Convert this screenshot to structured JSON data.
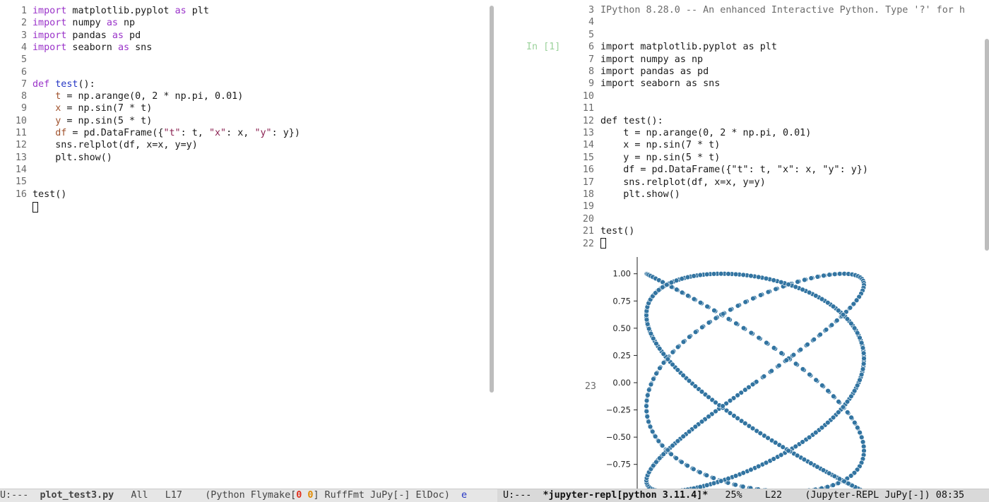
{
  "left_editor": {
    "lines": [
      {
        "n": "1",
        "html": "<span class='kw'>import</span> matplotlib.pyplot <span class='kw'>as</span> plt"
      },
      {
        "n": "2",
        "html": "<span class='kw'>import</span> numpy <span class='kw'>as</span> np"
      },
      {
        "n": "3",
        "html": "<span class='kw'>import</span> pandas <span class='kw'>as</span> pd"
      },
      {
        "n": "4",
        "html": "<span class='kw'>import</span> seaborn <span class='kw'>as</span> sns"
      },
      {
        "n": "5",
        "html": ""
      },
      {
        "n": "6",
        "html": ""
      },
      {
        "n": "7",
        "html": "<span class='kw'>def</span> <span class='fn'>test</span>():"
      },
      {
        "n": "8",
        "html": "    <span class='var'>t</span> = np.arange(0, 2 * np.pi, 0.01)"
      },
      {
        "n": "9",
        "html": "    <span class='var'>x</span> = np.sin(7 * t)"
      },
      {
        "n": "10",
        "html": "    <span class='var'>y</span> = np.sin(5 * t)"
      },
      {
        "n": "11",
        "html": "    <span class='var'>df</span> = pd.DataFrame({<span class='str'>\"t\"</span>: t, <span class='str'>\"x\"</span>: x, <span class='str'>\"y\"</span>: y})"
      },
      {
        "n": "12",
        "html": "    sns.relplot(df, x=x, y=y)"
      },
      {
        "n": "13",
        "html": "    plt.show()"
      },
      {
        "n": "14",
        "html": ""
      },
      {
        "n": "15",
        "html": ""
      },
      {
        "n": "16",
        "html": "test()"
      }
    ]
  },
  "repl": {
    "in_prompt": "In [1]",
    "lines": [
      {
        "n": "3",
        "text": "IPython 8.28.0 -- An enhanced Interactive Python. Type '?' for h"
      },
      {
        "n": "4",
        "text": ""
      },
      {
        "n": "5",
        "text": ""
      },
      {
        "n": "6",
        "text": "import matplotlib.pyplot as plt"
      },
      {
        "n": "7",
        "text": "import numpy as np"
      },
      {
        "n": "8",
        "text": "import pandas as pd"
      },
      {
        "n": "9",
        "text": "import seaborn as sns"
      },
      {
        "n": "10",
        "text": ""
      },
      {
        "n": "11",
        "text": ""
      },
      {
        "n": "12",
        "text": "def test():"
      },
      {
        "n": "13",
        "text": "    t = np.arange(0, 2 * np.pi, 0.01)"
      },
      {
        "n": "14",
        "text": "    x = np.sin(7 * t)"
      },
      {
        "n": "15",
        "text": "    y = np.sin(5 * t)"
      },
      {
        "n": "16",
        "text": "    df = pd.DataFrame({\"t\": t, \"x\": x, \"y\": y})"
      },
      {
        "n": "17",
        "text": "    sns.relplot(df, x=x, y=y)"
      },
      {
        "n": "18",
        "text": "    plt.show()"
      },
      {
        "n": "19",
        "text": ""
      },
      {
        "n": "20",
        "text": ""
      },
      {
        "n": "21",
        "text": "test()"
      },
      {
        "n": "22",
        "text": ""
      }
    ],
    "plot_line_number": "23"
  },
  "mode_line_left": {
    "status": "U:---  ",
    "buffer": "plot_test3.py",
    "pos": "   All   L17    ",
    "mode_prefix": "(Python Flymake[",
    "errors": "0",
    "warnings": "0",
    "mode_suffix": "] RuffFmt JuPy[-] ElDoc)  ",
    "trunc": "e"
  },
  "mode_line_right": {
    "status": " U:---  ",
    "buffer": "*jupyter-repl[python 3.11.4]*",
    "pos": "   25%    L22    ",
    "modes": "(Jupyter-REPL JuPy[-]) 08:35"
  },
  "chart_data": {
    "type": "scatter",
    "title": "",
    "xlabel": "",
    "ylabel": "",
    "y_ticks": [
      "1.00",
      "0.75",
      "0.50",
      "0.25",
      "0.00",
      "−0.25",
      "−0.50",
      "−0.75"
    ],
    "y_tick_values": [
      1.0,
      0.75,
      0.5,
      0.25,
      0.0,
      -0.25,
      -0.5,
      -0.75
    ],
    "xlim": [
      -1.0,
      1.0
    ],
    "ylim": [
      -1.05,
      1.05
    ],
    "series": [
      {
        "generator": "x = sin(7*t), y = sin(5*t), t = 0..2π step 0.01",
        "color": "#3274a1",
        "t_step": 0.01,
        "fx": 7,
        "fy": 5
      }
    ]
  },
  "colors": {
    "marker": "#3274a1",
    "marker_edge": "#ffffff",
    "keyword": "#9a33c9",
    "function": "#2536c4"
  }
}
